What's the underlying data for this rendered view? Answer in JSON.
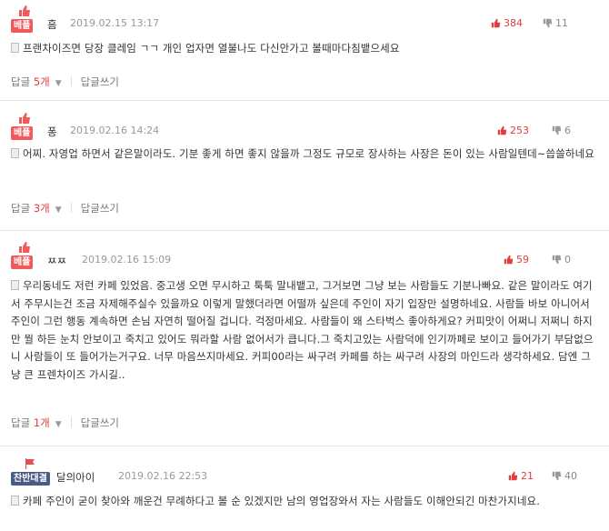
{
  "comments": [
    {
      "badge": "베플",
      "badge_type": "best",
      "nick": "흠",
      "date": "2019.02.15 13:17",
      "likes": "384",
      "dislikes": "11",
      "text": "프랜차이즈면 당장 클레임 ㄱㄱ 개인 업자면 열불나도 다신안가고 볼때마다침뱉으세요",
      "reply_label": "답글",
      "reply_count": "5개",
      "write_label": "답글쓰기"
    },
    {
      "badge": "베플",
      "badge_type": "best",
      "nick": "퐁",
      "date": "2019.02.16 14:24",
      "likes": "253",
      "dislikes": "6",
      "text": "어찌. 자영업 하면서 같은말이라도. 기분 좋게 하면 좋지 않을까 그정도 규모로 장사하는 사장은 돈이 있는 사람일텐데~씁쓸하네요",
      "reply_label": "답글",
      "reply_count": "3개",
      "write_label": "답글쓰기"
    },
    {
      "badge": "베플",
      "badge_type": "best",
      "nick": "ㅉㅉ",
      "date": "2019.02.16 15:09",
      "likes": "59",
      "dislikes": "0",
      "text": "우리동네도 저런 카페 있었음. 중고생 오면 무시하고 툭툭 말내뱉고, 그거보면 그냥 보는 사람들도 기분나빠요. 같은 말이라도 여기서 주무시는건 조금 자제해주실수 있을까요 이렇게 말했더라면 어떨까 싶은데 주인이 자기 입장만 설명하네요. 사람들 바보 아니어서 주인이 그런 행동 계속하면 손님 자연히 떨어질 겁니다. 걱정마세요. 사람들이 왜 스타벅스 좋아하게요? 커피맛이 어쩌니 저쩌니 하지만 뭘 하든 눈치 안보이고 죽치고 있어도 뭐라할 사람 없어서가 큽니다.그 죽치고있는 사람덕에 인기까페로 보이고 들어가기 부담없으니 사람들이 또 들어가는거구요. 너무 마음쓰지마세요. 커피00라는 싸구려 카페를 하는 싸구려 사장의 마인드라 생각하세요. 담엔 그냥 큰 프렌차이즈 가시길..",
      "reply_label": "답글",
      "reply_count": "1개",
      "write_label": "답글쓰기"
    },
    {
      "badge": "찬반대결",
      "badge_type": "debate",
      "nick": "달의아이",
      "date": "2019.02.16 22:53",
      "likes": "21",
      "dislikes": "40",
      "text": "카페 주인이 굳이 찾아와 깨운건 무례하다고 볼 순 있겠지만 남의 영업장와서 자는 사람들도 이해안되긴 마찬가지네요."
    }
  ],
  "colors": {
    "accent": "#e23c3c",
    "best_badge": "#f05a5a",
    "debate_badge": "#4a5a86"
  }
}
